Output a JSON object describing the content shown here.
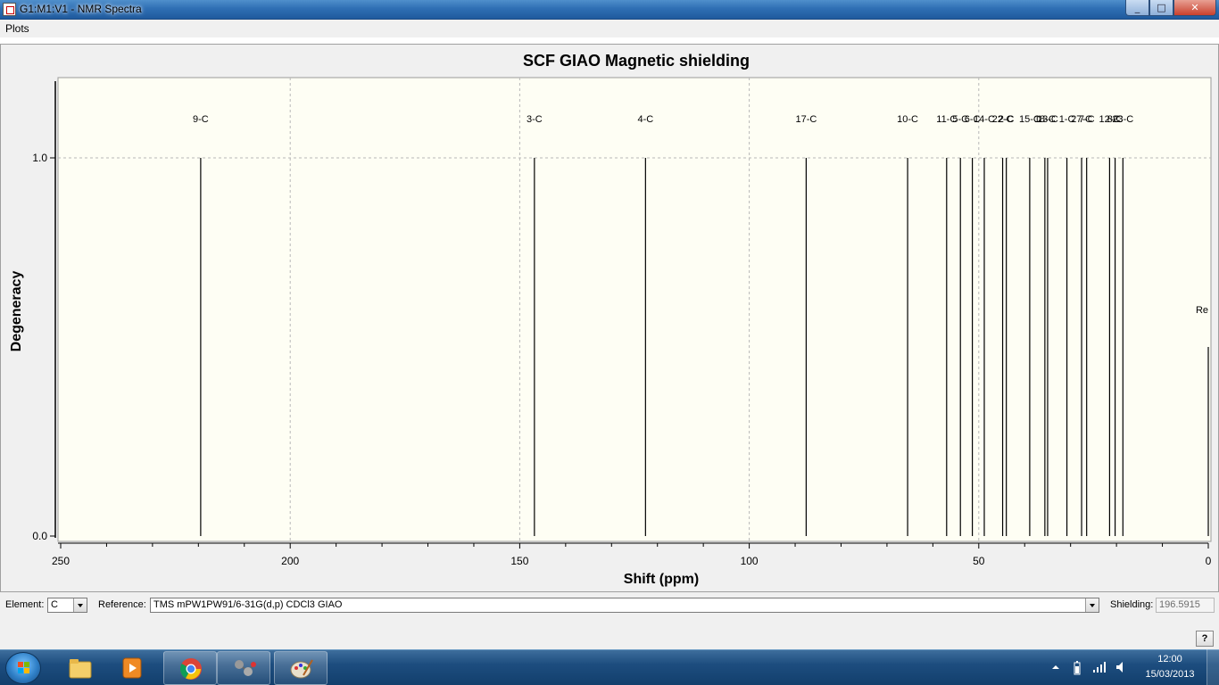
{
  "window": {
    "title": "G1:M1:V1 - NMR Spectra",
    "controls": [
      "_",
      "□",
      "✕"
    ]
  },
  "menu": {
    "items": [
      "Plots"
    ]
  },
  "chart_data": {
    "type": "bar",
    "title": "SCF GIAO Magnetic shielding",
    "xlabel": "Shift (ppm)",
    "ylabel": "Degeneracy",
    "xlim": [
      250,
      0
    ],
    "ylim": [
      0,
      1.2
    ],
    "x_ticks": [
      "250",
      "200",
      "150",
      "100",
      "50",
      "0"
    ],
    "y_ticks": [
      "1.0",
      "0.0"
    ],
    "grid": true,
    "peaks": [
      {
        "label": "9-C",
        "shift": 219.5,
        "value": 1.0
      },
      {
        "label": "3-C",
        "shift": 146.8,
        "value": 1.0
      },
      {
        "label": "4-C",
        "shift": 122.6,
        "value": 1.0
      },
      {
        "label": "17-C",
        "shift": 87.6,
        "value": 1.0
      },
      {
        "label": "10-C",
        "shift": 65.5,
        "value": 1.0
      },
      {
        "label": "11-C",
        "shift": 57.0,
        "value": 1.0
      },
      {
        "label": "5-C",
        "shift": 54.0,
        "value": 1.0
      },
      {
        "label": "6-C",
        "shift": 51.4,
        "value": 1.0
      },
      {
        "label": "14-C",
        "shift": 48.8,
        "value": 1.0
      },
      {
        "label": "22-C",
        "shift": 44.8,
        "value": 1.0
      },
      {
        "label": "2-C",
        "shift": 44.0,
        "value": 1.0
      },
      {
        "label": "15-C",
        "shift": 38.9,
        "value": 1.0
      },
      {
        "label": "18-C",
        "shift": 35.6,
        "value": 1.0
      },
      {
        "label": "13-C",
        "shift": 35.0,
        "value": 1.0
      },
      {
        "label": "1-C",
        "shift": 30.8,
        "value": 1.0
      },
      {
        "label": "27-C",
        "shift": 27.6,
        "value": 1.0
      },
      {
        "label": "7-C",
        "shift": 26.5,
        "value": 1.0
      },
      {
        "label": "12-C",
        "shift": 21.5,
        "value": 1.0
      },
      {
        "label": "8-C",
        "shift": 20.3,
        "value": 1.0
      },
      {
        "label": "23-C",
        "shift": 18.6,
        "value": 1.0
      },
      {
        "label": "Re",
        "shift": 0.0,
        "value": 0.5
      }
    ]
  },
  "controls": {
    "element_label": "Element:",
    "element_value": "C",
    "reference_label": "Reference:",
    "reference_value": "TMS mPW1PW91/6-31G(d,p) CDCl3 GIAO",
    "shielding_label": "Shielding:",
    "shielding_value": "196.5915",
    "help_label": "?"
  },
  "taskbar": {
    "time": "12:00",
    "date": "15/03/2013",
    "apps": [
      "windows-explorer",
      "media-player",
      "chrome",
      "gaussview",
      "paint"
    ]
  }
}
